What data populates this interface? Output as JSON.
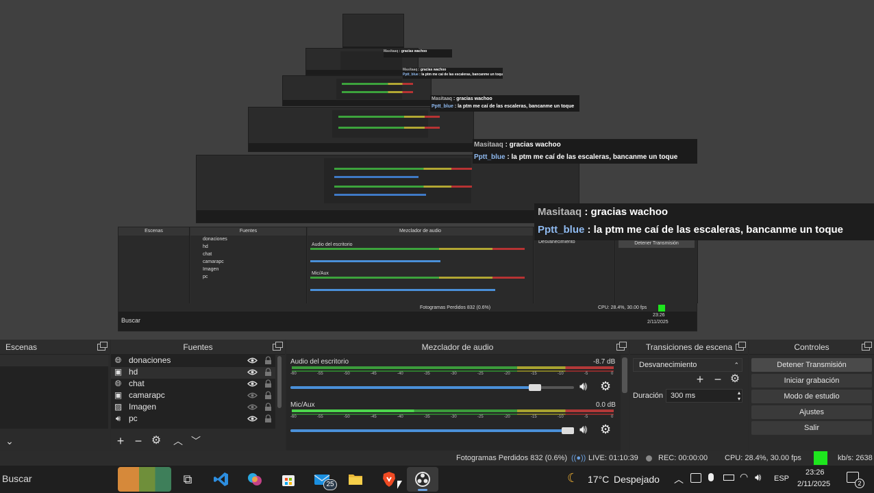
{
  "chat": [
    {
      "user": "Masitaaq",
      "message": " : gracias wachoo"
    },
    {
      "user": "Pptt_blue",
      "message": " : la ptm me caí de las escaleras, bancanme un toque"
    }
  ],
  "scenes_panel": {
    "title": "Escenas"
  },
  "sources_panel": {
    "title": "Fuentes",
    "items": [
      {
        "name": "donaciones",
        "icon": "globe-icon"
      },
      {
        "name": "hd",
        "icon": "camera-icon"
      },
      {
        "name": "chat",
        "icon": "globe-icon"
      },
      {
        "name": "camarapc",
        "icon": "camera-icon"
      },
      {
        "name": "Imagen",
        "icon": "image-icon"
      },
      {
        "name": "pc",
        "icon": "speaker-icon"
      }
    ]
  },
  "mixer_panel": {
    "title": "Mezclador de audio",
    "channels": [
      {
        "name": "Audio del escritorio",
        "db": "-8.7 dB",
        "volume_fraction": 0.88
      },
      {
        "name": "Mic/Aux",
        "db": "0.0 dB",
        "volume_fraction": 1.0
      }
    ],
    "tick_labels": [
      "-60",
      "-55",
      "-50",
      "-45",
      "-40",
      "-35",
      "-30",
      "-25",
      "-20",
      "-15",
      "-10",
      "-5",
      "0"
    ]
  },
  "transitions_panel": {
    "title": "Transiciones de escena",
    "transition": "Desvanecimiento",
    "duration_label": "Duración",
    "duration_value": "300 ms"
  },
  "controls_panel": {
    "title": "Controles",
    "buttons": [
      "Detener Transmisión",
      "Iniciar grabación",
      "Modo de estudio",
      "Ajustes",
      "Salir"
    ]
  },
  "status": {
    "dropped_frames": "Fotogramas Perdidos 832 (0.6%)",
    "live": "LIVE: 01:10:39",
    "rec": "REC: 00:00:00",
    "cpu": "CPU: 28.4%, 30.00 fps",
    "kbps": "kb/s: 2638",
    "health_color": "#1ee61e"
  },
  "taskbar": {
    "search": "Buscar",
    "weather_temp": "17°C",
    "weather_desc": "Despejado",
    "language": "ESP",
    "time": "23:26",
    "date": "2/11/2025",
    "mail_badge": "25",
    "notification_badge": "2"
  }
}
